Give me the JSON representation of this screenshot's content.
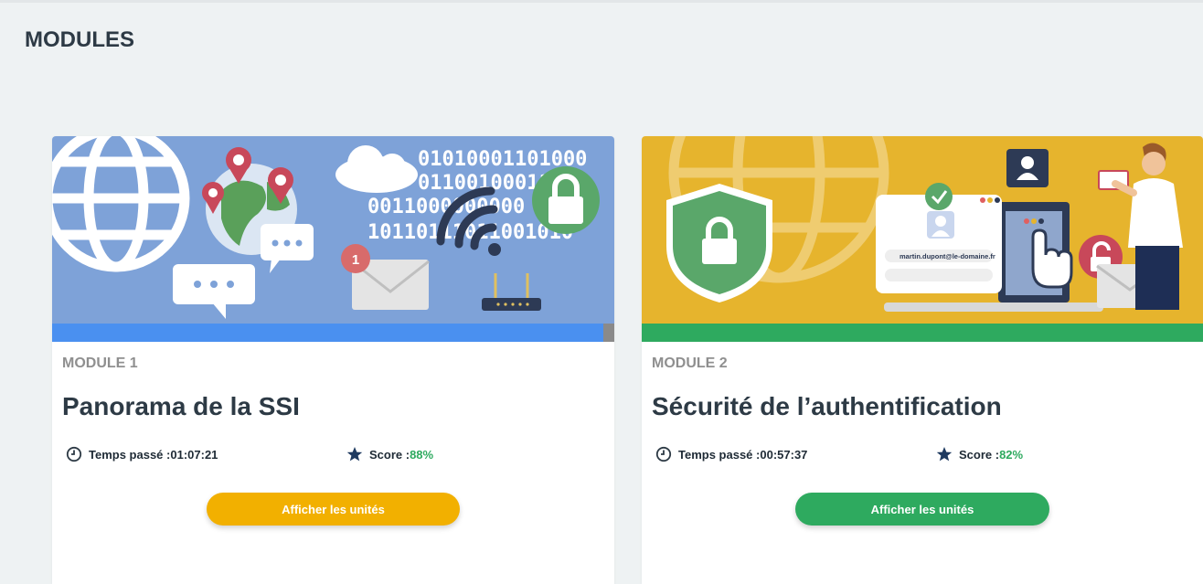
{
  "page": {
    "title": "MODULES"
  },
  "colors": {
    "progress1": "#4a90f0",
    "progress2": "#2eaa5f",
    "btn1": "#f2b000",
    "btn2": "#2eaa5f",
    "score": "#2eaa5f"
  },
  "modules": [
    {
      "label": "MODULE 1",
      "title": "Panorama de la SSI",
      "time_label": "Temps passé : ",
      "time_value": "01:07:21",
      "score_label": "Score : ",
      "score_value": "88%",
      "progress": 0.98,
      "button_label": "Afficher les unités",
      "banner": {
        "binary_lines": [
          "01010001101000",
          "01100100011001",
          "0011000000000",
          "10110111011001010"
        ],
        "badge_count": "1"
      }
    },
    {
      "label": "MODULE 2",
      "title": "Sécurité de l’authentification",
      "time_label": "Temps passé : ",
      "time_value": "00:57:37",
      "score_label": "Score : ",
      "score_value": "82%",
      "progress": 1.0,
      "button_label": "Afficher les unités",
      "banner": {
        "email_text": "martin.dupont@le-domaine.fr"
      }
    }
  ]
}
